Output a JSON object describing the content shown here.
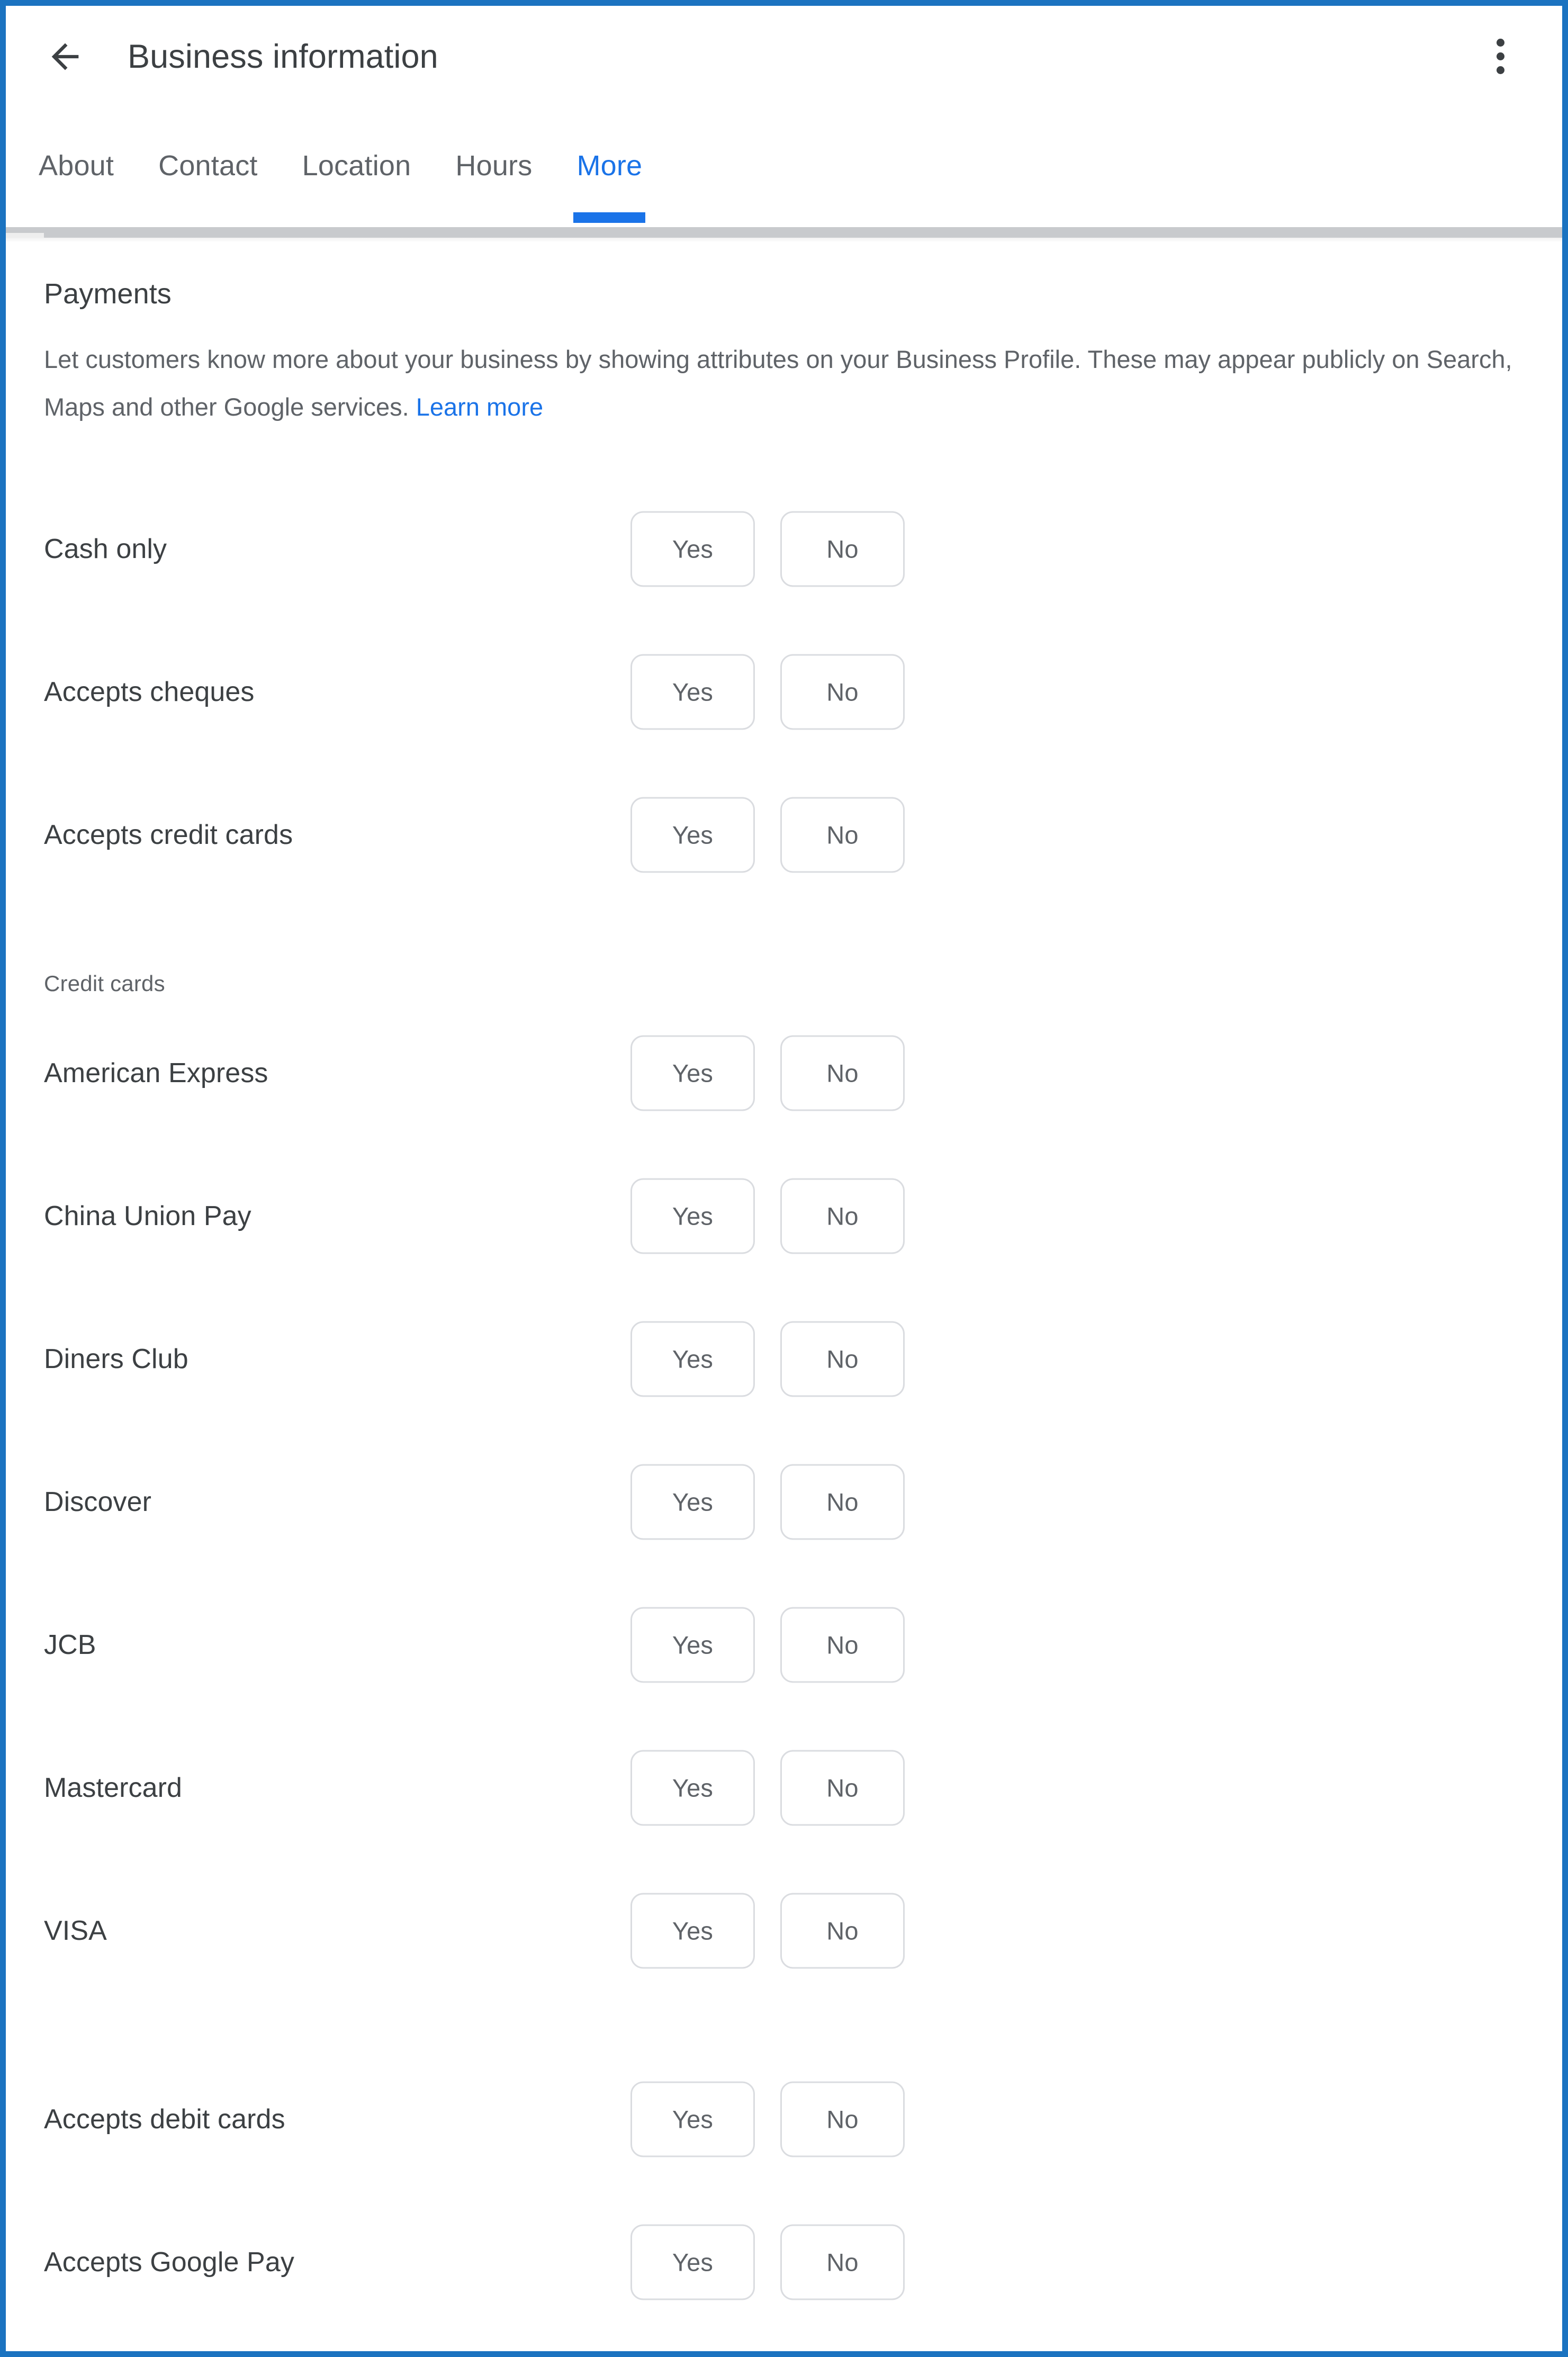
{
  "window": {
    "frame_color": "#1b73c0",
    "accent_color": "#1a73e8",
    "label_color": "#3c4043",
    "muted_color": "#5f6368",
    "border_color": "#dadce0"
  },
  "appbar": {
    "back_icon": "arrow-back-icon",
    "title": "Business information",
    "overflow_icon": "more-vert-icon"
  },
  "tabs": [
    {
      "label": "About",
      "active": false
    },
    {
      "label": "Contact",
      "active": false
    },
    {
      "label": "Location",
      "active": false
    },
    {
      "label": "Hours",
      "active": false
    },
    {
      "label": "More",
      "active": true
    }
  ],
  "section": {
    "title": "Payments",
    "description": "Let customers know more about your business by showing attributes on your Business Profile. These may appear publicly on Search, Maps and other Google services.",
    "learn_more_label": "Learn more"
  },
  "choices": {
    "yes_label": "Yes",
    "no_label": "No"
  },
  "groups": [
    {
      "subheader": null,
      "attributes": [
        {
          "label": "Cash only",
          "selected": null
        },
        {
          "label": "Accepts cheques",
          "selected": null
        },
        {
          "label": "Accepts credit cards",
          "selected": null
        }
      ]
    },
    {
      "subheader": "Credit cards",
      "attributes": [
        {
          "label": "American Express",
          "selected": null
        },
        {
          "label": "China Union Pay",
          "selected": null
        },
        {
          "label": "Diners Club",
          "selected": null
        },
        {
          "label": "Discover",
          "selected": null
        },
        {
          "label": "JCB",
          "selected": null
        },
        {
          "label": "Mastercard",
          "selected": null
        },
        {
          "label": "VISA",
          "selected": null
        }
      ]
    },
    {
      "subheader": null,
      "attributes": [
        {
          "label": "Accepts debit cards",
          "selected": null
        },
        {
          "label": "Accepts Google Pay",
          "selected": null
        }
      ]
    }
  ]
}
